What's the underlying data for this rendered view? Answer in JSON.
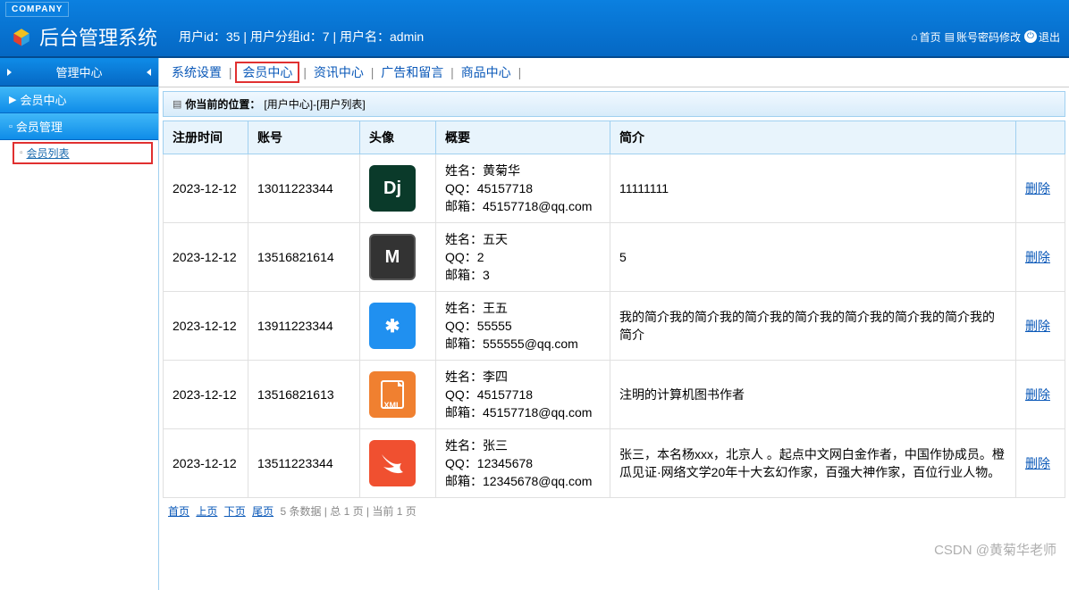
{
  "company_tag": "COMPANY",
  "system_title": "后台管理系统",
  "user_info": "用户id：35 | 用户分组id：7 | 用户名：admin",
  "header_links": {
    "home": "首页",
    "password": "账号密码修改",
    "exit": "退出"
  },
  "sidebar": {
    "header": "管理中心",
    "section1": "会员中心",
    "section2": "会员管理",
    "item": "会员列表"
  },
  "tabs": {
    "system": "系统设置",
    "member": "会员中心",
    "news": "资讯中心",
    "ads": "广告和留言",
    "goods": "商品中心"
  },
  "breadcrumb": {
    "label": "你当前的位置：",
    "path": "[用户中心]-[用户列表]"
  },
  "table": {
    "headers": {
      "reg_time": "注册时间",
      "account": "账号",
      "avatar": "头像",
      "summary": "概要",
      "intro": "简介",
      "op": ""
    },
    "rows": [
      {
        "reg_time": "2023-12-12",
        "account": "13011223344",
        "avatar_style": "dj",
        "avatar_text": "Dj",
        "summary": "姓名：黄菊华\nQQ：45157718\n邮箱：45157718@qq.com",
        "intro": "11111111",
        "op": "删除"
      },
      {
        "reg_time": "2023-12-12",
        "account": "13516821614",
        "avatar_style": "m",
        "avatar_text": "M",
        "summary": "姓名：五天\nQQ：2\n邮箱：3",
        "intro": "5",
        "op": "删除"
      },
      {
        "reg_time": "2023-12-12",
        "account": "13911223344",
        "avatar_style": "star",
        "avatar_text": "✱",
        "summary": "姓名：王五\nQQ：55555\n邮箱：555555@qq.com",
        "intro": "我的简介我的简介我的简介我的简介我的简介我的简介我的简介我的简介",
        "op": "删除"
      },
      {
        "reg_time": "2023-12-12",
        "account": "13516821613",
        "avatar_style": "xml",
        "avatar_text": "XML",
        "summary": "姓名：李四\nQQ：45157718\n邮箱：45157718@qq.com",
        "intro": "注明的计算机图书作者",
        "op": "删除"
      },
      {
        "reg_time": "2023-12-12",
        "account": "13511223344",
        "avatar_style": "swift",
        "avatar_text": "",
        "summary": "姓名：张三\nQQ：12345678\n邮箱：12345678@qq.com",
        "intro": "张三，本名杨xxx，北京人 。起点中文网白金作者，中国作协成员。橙瓜见证·网络文学20年十大玄幻作家，百强大神作家，百位行业人物。",
        "op": "删除"
      }
    ]
  },
  "pagination": {
    "first": "首页",
    "prev": "上页",
    "next": "下页",
    "last": "尾页",
    "info": "5 条数据 | 总 1 页 | 当前 1 页"
  },
  "watermark": "CSDN @黄菊华老师"
}
